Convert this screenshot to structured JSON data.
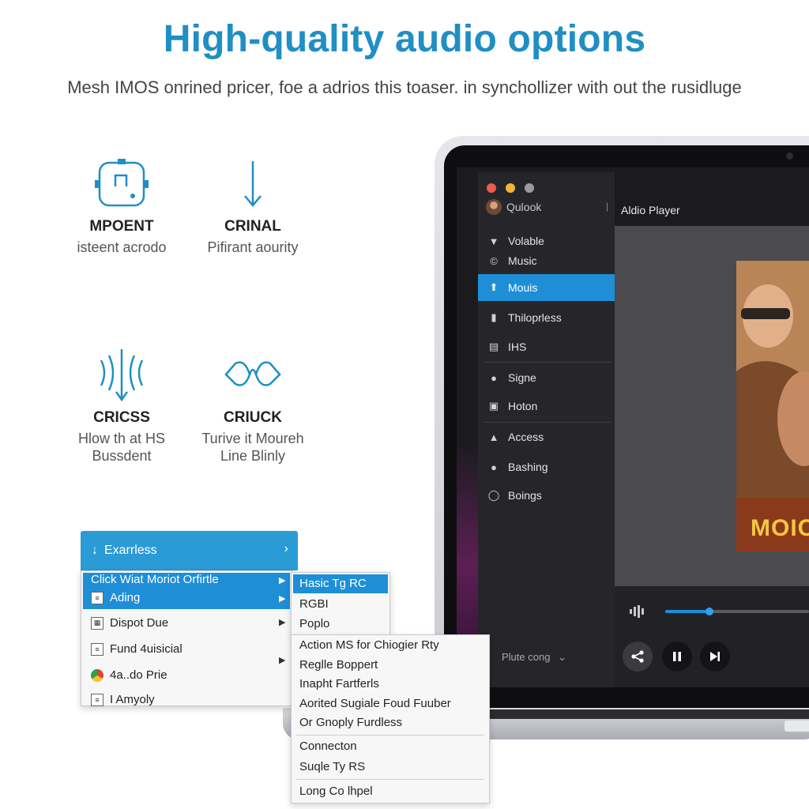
{
  "header": {
    "title": "High-quality audio options",
    "subtitle": "Mesh IMOS onrined pricer, foe a adrios this toaser. in synchollizer with out the rusidluge"
  },
  "features": [
    {
      "icon": "device-icon",
      "title": "MPOENT",
      "desc_lines": [
        "isteent acrodo"
      ]
    },
    {
      "icon": "arrow-down-icon",
      "title": "CRINAL",
      "desc_lines": [
        "Pifirant aourity"
      ]
    },
    {
      "icon": "sound-wave-icon",
      "title": "CRICSS",
      "desc_lines": [
        "Hlow th at HS",
        "Bussdent"
      ]
    },
    {
      "icon": "waveform-loop-icon",
      "title": "CRIUCK",
      "desc_lines": [
        "Turive it Moureh",
        "Line Blinly"
      ]
    }
  ],
  "app": {
    "user": {
      "name": "Qulook"
    },
    "nav": [
      {
        "label": "Volable",
        "icon": "volume-icon"
      },
      {
        "label": "Music",
        "icon": "copyright-icon"
      },
      {
        "label": "Mouis",
        "icon": "upload-arrow-icon",
        "active": true
      },
      {
        "label": "Thiloprless",
        "icon": "lock-icon"
      },
      {
        "label": "IHS",
        "icon": "keyboard-icon"
      },
      {
        "label": "Signe",
        "icon": "person-icon"
      },
      {
        "label": "Hoton",
        "icon": "window-icon"
      },
      {
        "label": "Access",
        "icon": "group-icon"
      },
      {
        "label": "Bashing",
        "icon": "person-icon"
      },
      {
        "label": "Boings",
        "icon": "power-icon"
      }
    ],
    "pane_title": "Aldio Player",
    "poster_text": "MOIC",
    "playback": {
      "progress": 0.31
    },
    "playlist_select": "Plute cong"
  },
  "menus": {
    "header": {
      "label": "Exarrless"
    },
    "main": [
      {
        "label": "Click Wiat Moriot Orfirtle",
        "icon": "",
        "highlighted": true,
        "has_submenu": true
      },
      {
        "label": "Ading",
        "icon": "list-icon",
        "highlighted": true,
        "has_submenu": true
      },
      {
        "label": "Dispot Due",
        "icon": "grid-icon",
        "highlighted": false,
        "has_submenu": true
      },
      {
        "label": "Fund 4uisicial",
        "icon": "document-icon",
        "highlighted": false,
        "has_submenu": false
      },
      {
        "label": "4a..do Prie",
        "icon": "chrome-icon",
        "highlighted": false,
        "has_submenu": true
      },
      {
        "label": "I Amyoly",
        "icon": "document-icon",
        "highlighted": false,
        "has_submenu": false
      }
    ],
    "sub1": [
      {
        "label": "Hasic Tg RC",
        "highlighted": true
      },
      {
        "label": "RGBI",
        "highlighted": false
      },
      {
        "label": "Poplo",
        "highlighted": false
      }
    ],
    "sub2_groups": [
      [
        "Action MS for Chiogier Rty",
        "Reglle Boppert",
        "Inapht Fartferls",
        "Aorited Sugiale Foud Fuuber",
        "Or Gnoply Furdless"
      ],
      [
        "Connecton",
        "Suqle Ty RS"
      ],
      [
        "Long Co lhpel"
      ]
    ]
  }
}
